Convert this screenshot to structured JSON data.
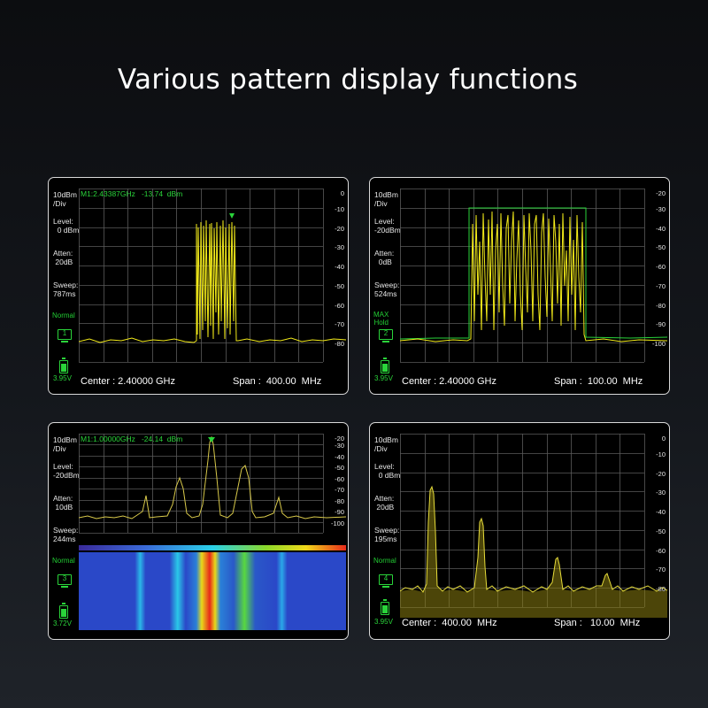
{
  "headline": "Various pattern display functions",
  "panels": [
    {
      "scale": "10dBm\n/Div",
      "level": "Level:\n  0 dBm",
      "atten": "Atten:\n 20dB",
      "sweep": "Sweep:\n787ms",
      "mode": "Normal",
      "display_number": "1",
      "voltage": "3.95V",
      "marker": "M1:2.43387GHz   -13.74  dBm",
      "center": "Center : 2.40000 GHz",
      "span": "Span :  400.00  MHz",
      "yticks": [
        "0",
        "-10",
        "-20",
        "-30",
        "-40",
        "-50",
        "-60",
        "-70",
        "-80"
      ]
    },
    {
      "scale": "10dBm\n/Div",
      "level": "Level:\n-20dBm",
      "atten": "Atten:\n  0dB",
      "sweep": "Sweep:\n524ms",
      "mode": "MAX\nHold",
      "display_number": "2",
      "voltage": "3.95V",
      "marker": "",
      "center": "Center : 2.40000 GHz",
      "span": "Span :  100.00  MHz",
      "yticks": [
        "-20",
        "-30",
        "-40",
        "-50",
        "-60",
        "-70",
        "-80",
        "-90",
        "-100"
      ]
    },
    {
      "scale": "10dBm\n/Div",
      "level": "Level:\n-20dBm",
      "atten": "Atten:\n 10dB",
      "sweep": "Sweep:\n244ms",
      "mode": "Normal",
      "display_number": "3",
      "voltage": "3.72V",
      "marker": "M1:1.00000GHz   -24.14  dBm",
      "center": "",
      "span": "",
      "yticks": [
        "-20",
        "-30",
        "-40",
        "-50",
        "-60",
        "-70",
        "-80",
        "-90",
        "-100"
      ]
    },
    {
      "scale": "10dBm\n/Div",
      "level": "Level:\n  0 dBm",
      "atten": "Atten:\n 20dB",
      "sweep": "Sweep:\n195ms",
      "mode": "Normal",
      "display_number": "4",
      "voltage": "3.95V",
      "marker": "",
      "center": "Center :  400.00  MHz",
      "span": "Span :   10.00  MHz",
      "yticks": [
        "0",
        "-10",
        "-20",
        "-30",
        "-40",
        "-50",
        "-60",
        "-70",
        "-80"
      ]
    }
  ],
  "colors": {
    "trace": "#f2ea1a",
    "grid": "#5a5a5a",
    "status": "#22cc33",
    "border": "#d9d9d9"
  }
}
